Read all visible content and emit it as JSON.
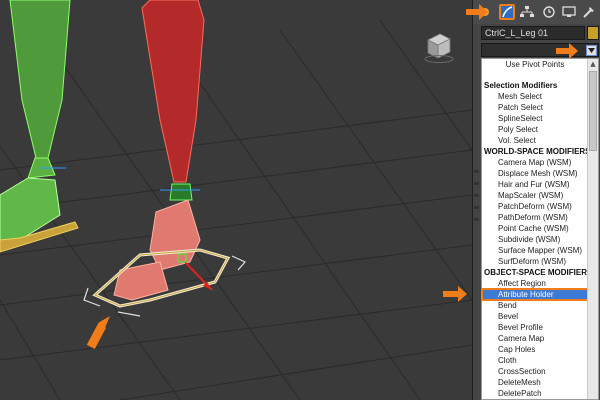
{
  "object_name": "CtrlC_L_Leg 01",
  "colors": {
    "accent": "#f07c1a",
    "selection": "#3d7ad6",
    "object_color": "#c7a02a"
  },
  "command_panel": {
    "tabs": [
      "sun-icon",
      "modify-icon",
      "hierarchy-icon",
      "motion-icon",
      "display-icon",
      "utilities-icon"
    ],
    "active_tab": "modify-icon"
  },
  "modifier_list": {
    "top_item": "Use Pivot Points",
    "sections": [
      {
        "header": "Selection Modifiers",
        "items": [
          "Mesh Select",
          "Patch Select",
          "SplineSelect",
          "Poly Select",
          "Vol. Select"
        ]
      },
      {
        "header": "WORLD-SPACE MODIFIERS",
        "items": [
          "Camera Map (WSM)",
          "Displace Mesh (WSM)",
          "Hair and Fur (WSM)",
          "MapScaler (WSM)",
          "PatchDeform (WSM)",
          "PathDeform (WSM)",
          "Point Cache (WSM)",
          "Subdivide (WSM)",
          "Surface Mapper (WSM)",
          "SurfDeform (WSM)"
        ]
      },
      {
        "header": "OBJECT-SPACE MODIFIERS",
        "items": [
          "Affect Region",
          "Attribute Holder",
          "Bend",
          "Bevel",
          "Bevel Profile",
          "Camera Map",
          "Cap Holes",
          "Cloth",
          "CrossSection",
          "DeleteMesh",
          "DeletePatch"
        ]
      }
    ],
    "selected_item": "Attribute Holder"
  }
}
